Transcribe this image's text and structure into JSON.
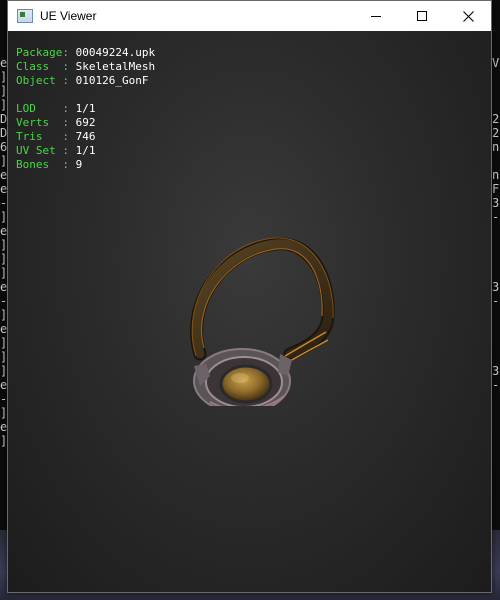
{
  "window": {
    "title": "UE Viewer"
  },
  "info": {
    "package_label": "Package: ",
    "package_value": "00049224.upk",
    "class_label": "Class  : ",
    "class_value": "SkeletalMesh",
    "object_label": "Object : ",
    "object_value": "010126_GonF",
    "lod_label": "LOD    : ",
    "lod_value": "1/1",
    "verts_label": "Verts  : ",
    "verts_value": "692",
    "tris_label": "Tris   : ",
    "tris_value": "746",
    "uvset_label": "UV Set : ",
    "uvset_value": "1/1",
    "bones_label": "Bones  : ",
    "bones_value": "9"
  },
  "background_console": {
    "left_column": "e\n]\n]\n]\nD\nD\n6\n]\ne\ne\n-\n]\ne\n]\n]\n]\ne\n-\n]\ne\n]\n]\n]\ne\n-\n]\ne\n]",
    "right_column": "V\n\n\n\n2\n2\nn\n\nn\nF\n3\n-\n\n\n\n\n3\n-\n\n\n\n\n3\n-"
  },
  "colors": {
    "label_green": "#49d649",
    "value_white": "#ffffff"
  },
  "icons": {
    "app": "app-window-icon",
    "minimize": "minimize-icon",
    "maximize": "maximize-icon",
    "close": "close-icon"
  }
}
